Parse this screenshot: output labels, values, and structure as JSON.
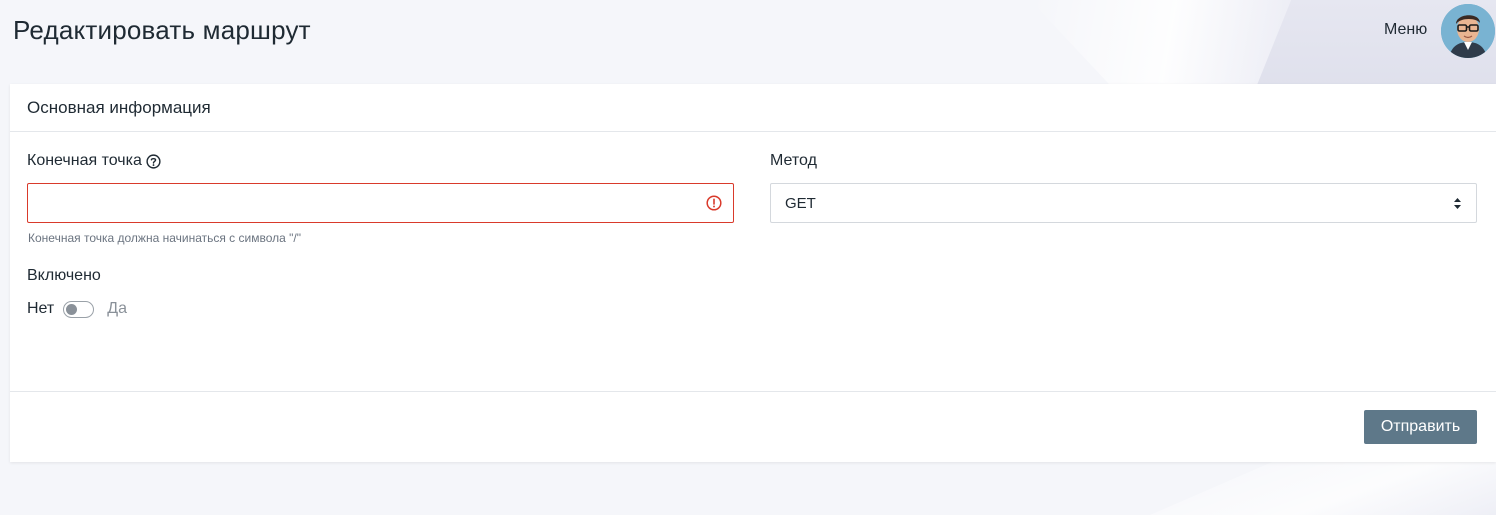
{
  "header": {
    "title": "Редактировать маршрут",
    "menu_label": "Меню",
    "avatar_icon": "user-avatar"
  },
  "card": {
    "title": "Основная информация",
    "endpoint": {
      "label": "Конечная точка",
      "value": "",
      "placeholder": "",
      "hint": "Конечная точка должна начинаться с символа \"/\"",
      "help_icon": "question-circle-icon",
      "error_icon": "exclamation-circle-icon"
    },
    "method": {
      "label": "Метод",
      "selected": "GET",
      "icon": "sort-arrows-icon"
    },
    "enabled": {
      "label": "Включено",
      "off_label": "Нет",
      "on_label": "Да",
      "value": false
    },
    "submit_label": "Отправить"
  },
  "colors": {
    "error": "#d93a2b",
    "button": "#5e7889",
    "background": "#f5f6fa"
  }
}
